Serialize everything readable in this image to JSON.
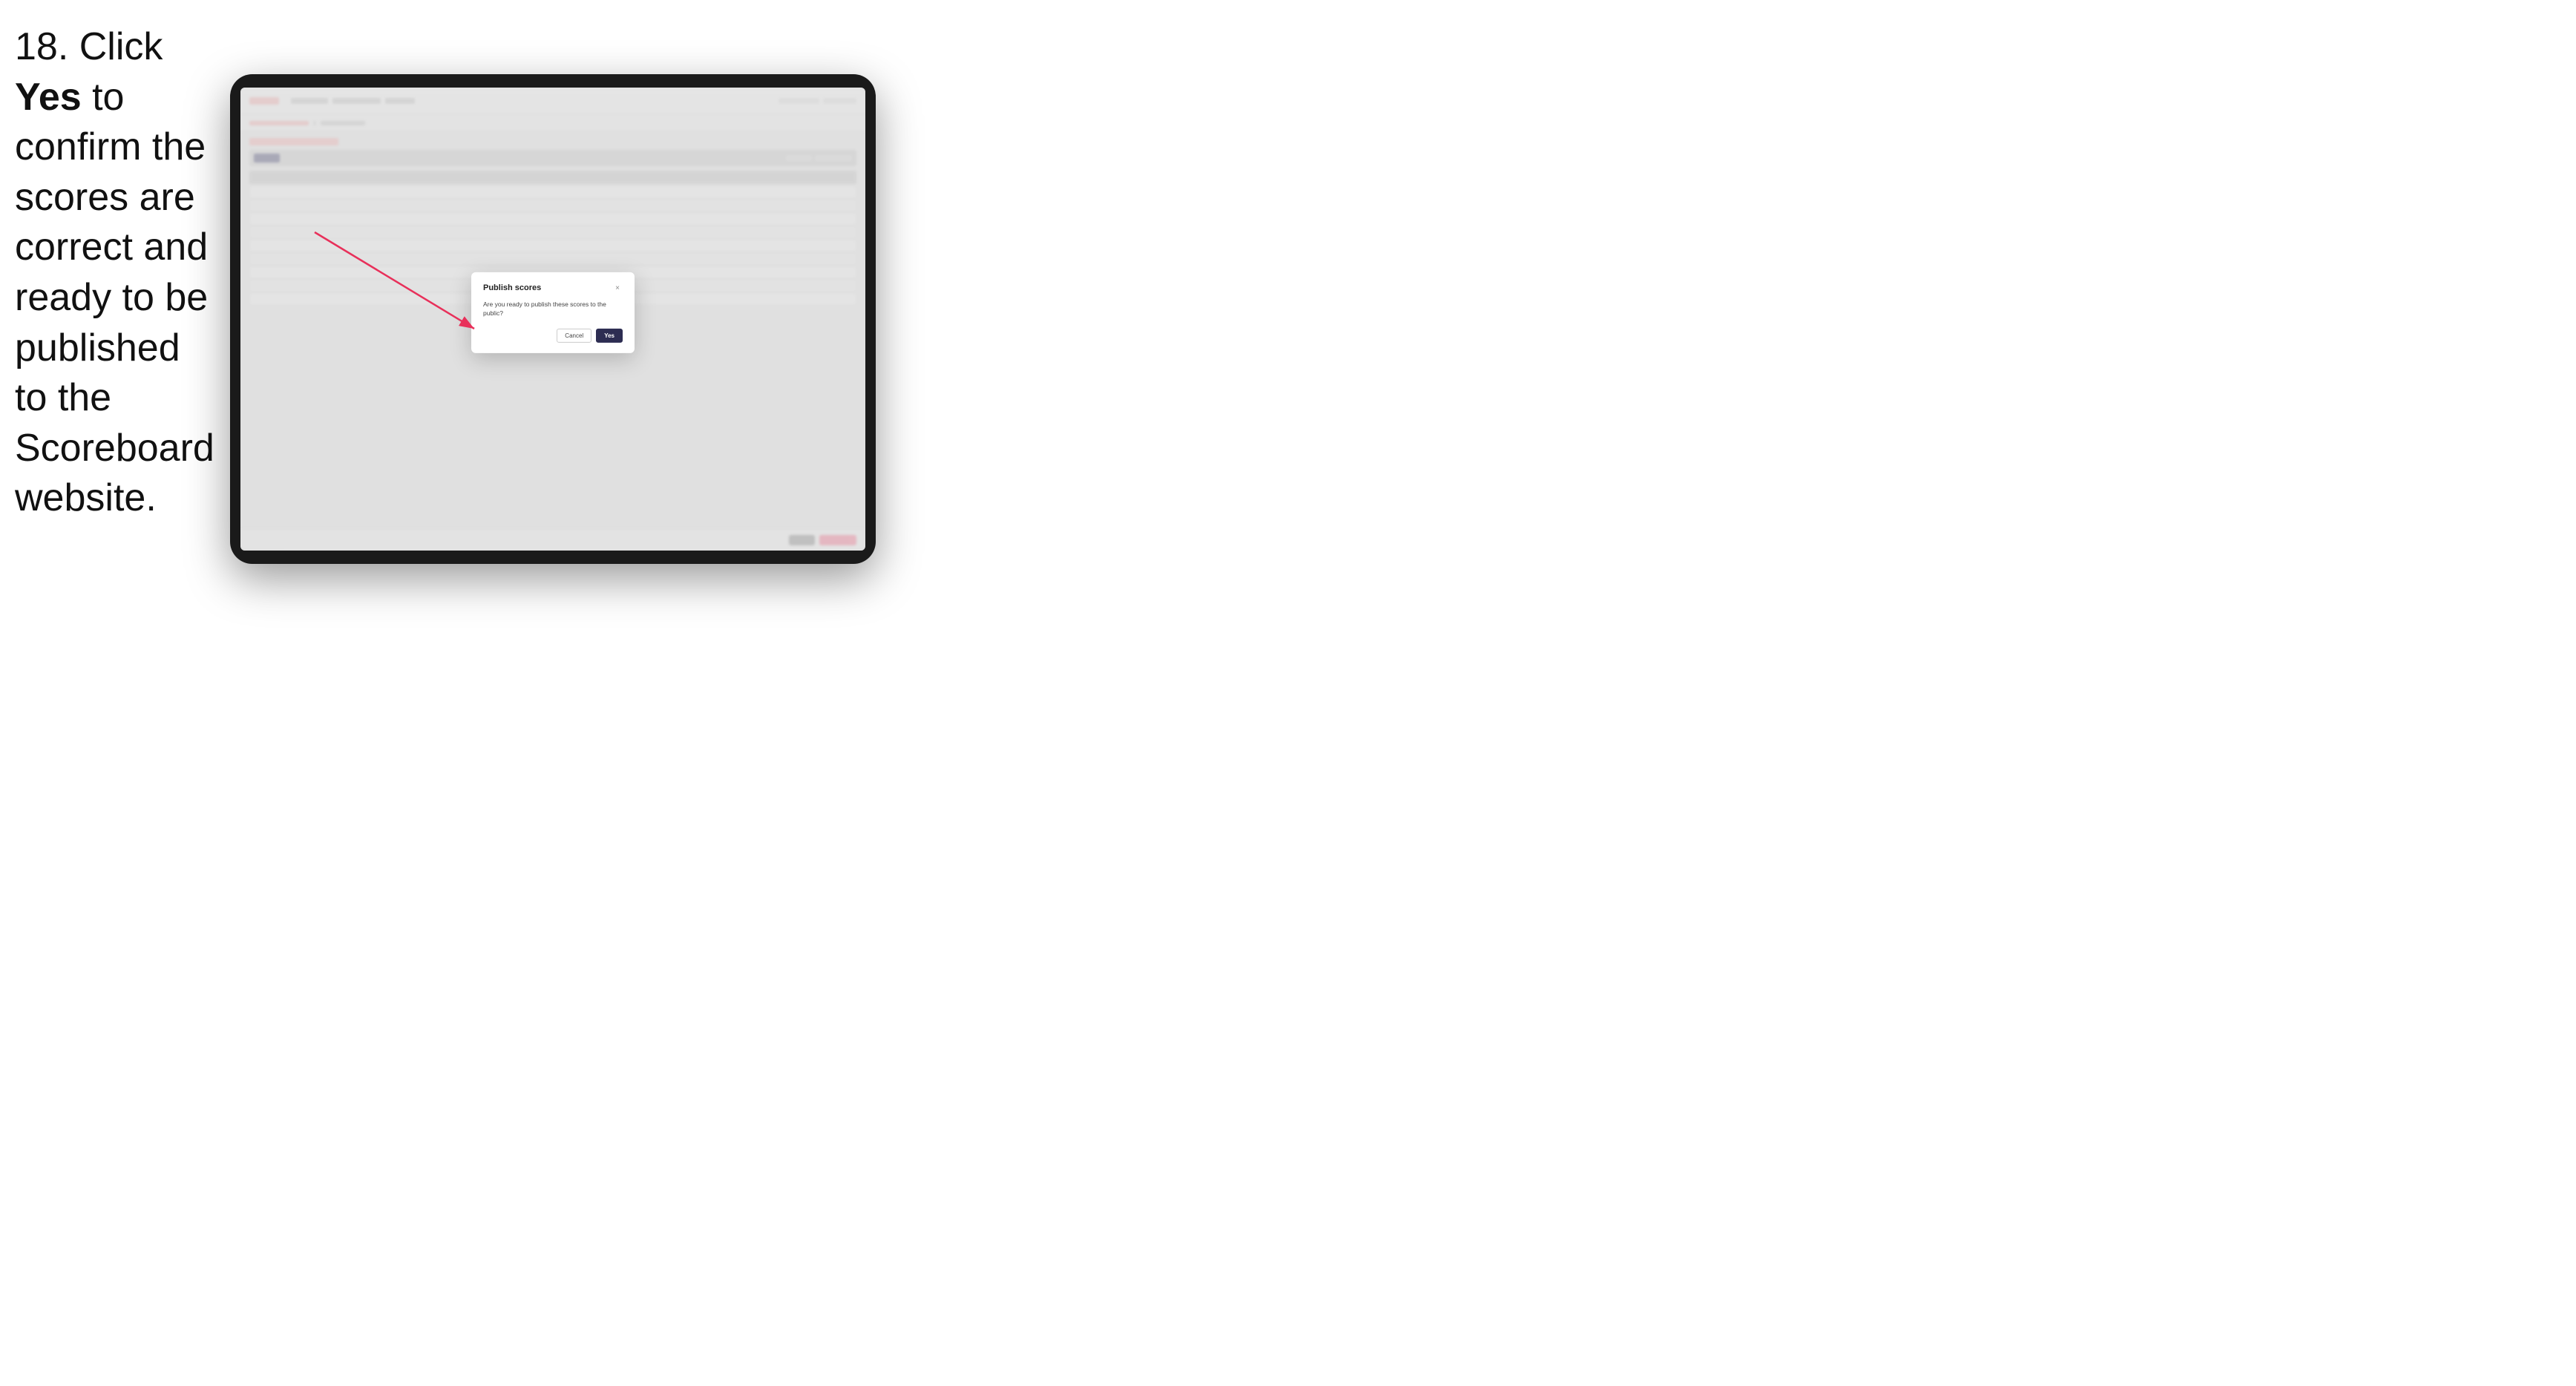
{
  "instruction": {
    "step_number": "18.",
    "text": " Click ",
    "bold_text": "Yes",
    "text2": " to confirm the scores are correct and ready to be published to the Scoreboard website."
  },
  "tablet": {
    "bg": {
      "nav_items": [
        "Customise/Edit",
        "Events"
      ],
      "breadcrumb": [
        "Flight Schedule",
        ">",
        "Results"
      ],
      "btn_label": "Submit",
      "table_rows": 8
    },
    "modal": {
      "title": "Publish scores",
      "message": "Are you ready to publish these scores to the public?",
      "cancel_label": "Cancel",
      "yes_label": "Yes",
      "close_icon": "×"
    }
  }
}
